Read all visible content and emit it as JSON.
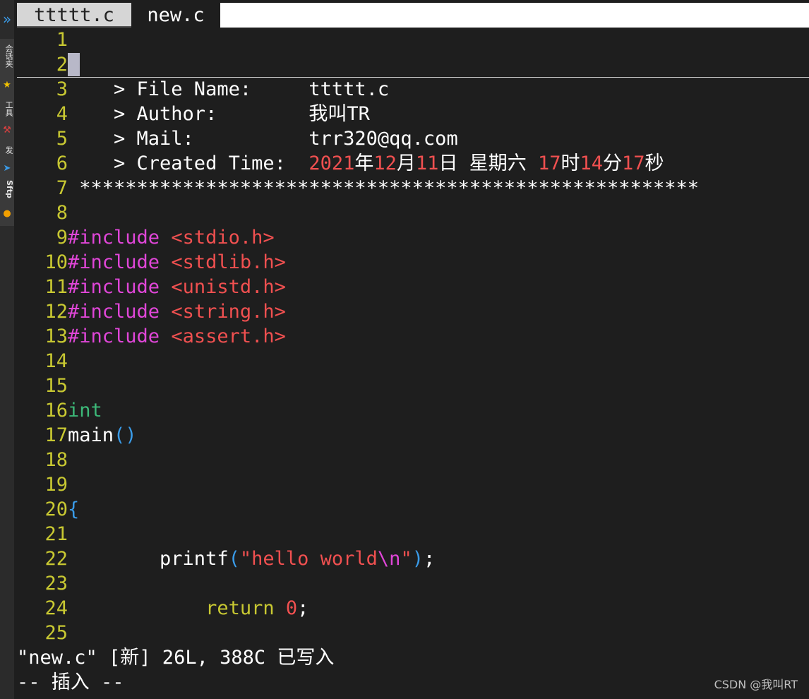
{
  "tabs": [
    {
      "label": "ttttt.c"
    },
    {
      "label": "new.c"
    }
  ],
  "sidebar": {
    "labels": [
      "会话夹",
      "工具",
      "发",
      "Sftp"
    ],
    "icons": [
      "star-icon",
      "tool-icon",
      "send-icon",
      "sftp-icon"
    ]
  },
  "editor": {
    "line_numbers": [
      "1",
      "2",
      "3",
      "4",
      "5",
      "6",
      "7",
      "8",
      "9",
      "10",
      "11",
      "12",
      "13",
      "14",
      "15",
      "16",
      "17",
      "18",
      "19",
      "20",
      "21",
      "22",
      "23",
      "24",
      "25"
    ],
    "header": {
      "file_name_label": "    > File Name:     ",
      "file_name": "ttttt.c",
      "author_label": "    > Author:        ",
      "author": "我叫TR",
      "mail_label": "    > Mail:          ",
      "mail": "trr320@qq.com",
      "created_label": "    > Created Time:  ",
      "created_year": "2021",
      "created_y": "年",
      "created_month": "12",
      "created_m": "月",
      "created_day": "11",
      "created_d": "日 星期六 ",
      "created_hour": "17",
      "created_h": "时",
      "created_min": "14",
      "created_mi": "分",
      "created_sec": "17",
      "created_s": "秒",
      "stars": " ******************************************************"
    },
    "includes": [
      "<stdio.h>",
      "<stdlib.h>",
      "<unistd.h>",
      "<string.h>",
      "<assert.h>"
    ],
    "include_kw": "#include",
    "type_int": "int",
    "func_main": "main",
    "func_parens": "()",
    "brace_open": "{",
    "printf_name": "        printf",
    "printf_open": "(",
    "printf_q1": "\"",
    "printf_text": "hello world",
    "printf_esc": "\\n",
    "printf_q2": "\"",
    "printf_close": ")",
    "printf_semi": ";",
    "return_kw": "            return",
    "return_val": "0",
    "return_semi": ";"
  },
  "status": {
    "message": "\"new.c\" [新] 26L, 388C 已写入",
    "mode": "-- 插入 --"
  },
  "watermark": "CSDN @我叫RT"
}
